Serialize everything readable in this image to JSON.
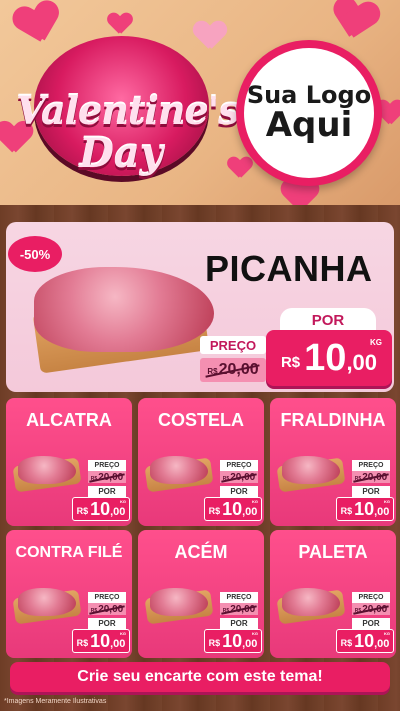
{
  "header": {
    "theme_line1": "Valentine's",
    "theme_line2": "Day",
    "logo_line1": "Sua Logo",
    "logo_line2": "Aqui"
  },
  "featured": {
    "discount": "-50%",
    "name": "PICANHA",
    "preco_label": "PREÇO",
    "old_currency": "R$",
    "old_price": "20,00",
    "por_label": "POR",
    "new_currency": "R$",
    "new_int": "10",
    "new_dec": ",00",
    "unit": "KG"
  },
  "products": [
    {
      "name": "ALCATRA",
      "preco_label": "PREÇO",
      "old_currency": "R$",
      "old_price": "20,00",
      "por_label": "POR",
      "new_currency": "R$",
      "new_int": "10",
      "new_dec": ",00",
      "unit": "KG"
    },
    {
      "name": "COSTELA",
      "preco_label": "PREÇO",
      "old_currency": "R$",
      "old_price": "20,00",
      "por_label": "POR",
      "new_currency": "R$",
      "new_int": "10",
      "new_dec": ",00",
      "unit": "KG"
    },
    {
      "name": "FRALDINHA",
      "preco_label": "PREÇO",
      "old_currency": "R$",
      "old_price": "20,00",
      "por_label": "POR",
      "new_currency": "R$",
      "new_int": "10",
      "new_dec": ",00",
      "unit": "KG"
    },
    {
      "name": "CONTRA FILÉ",
      "preco_label": "PREÇO",
      "old_currency": "R$",
      "old_price": "20,00",
      "por_label": "POR",
      "new_currency": "R$",
      "new_int": "10",
      "new_dec": ",00",
      "unit": "KG"
    },
    {
      "name": "ACÉM",
      "preco_label": "PREÇO",
      "old_currency": "R$",
      "old_price": "20,00",
      "por_label": "POR",
      "new_currency": "R$",
      "new_int": "10",
      "new_dec": ",00",
      "unit": "KG"
    },
    {
      "name": "PALETA",
      "preco_label": "PREÇO",
      "old_currency": "R$",
      "old_price": "20,00",
      "por_label": "POR",
      "new_currency": "R$",
      "new_int": "10",
      "new_dec": ",00",
      "unit": "KG"
    }
  ],
  "cta": "Crie seu encarte com este tema!",
  "footnote": "*Imagens Meramente Ilustrativas",
  "colors": {
    "accent": "#e91e63",
    "card": "#ff4f8c",
    "featured_bg": "#f7d6e3",
    "wood": "#6e3d26"
  }
}
